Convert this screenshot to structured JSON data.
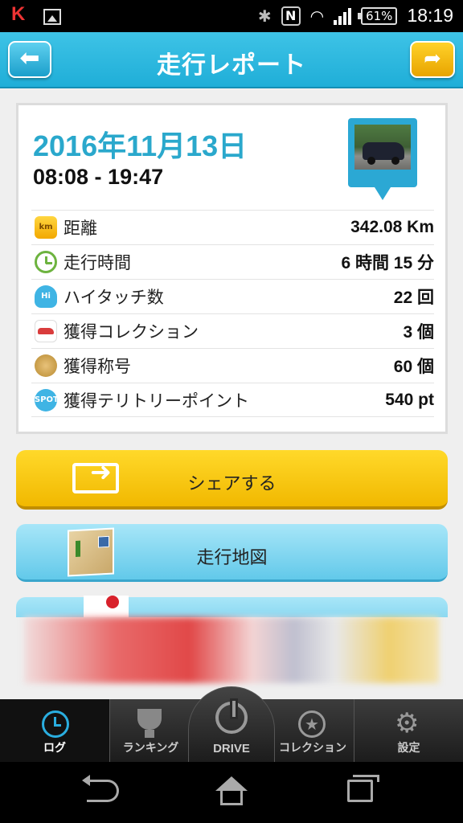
{
  "status_bar": {
    "battery": "61%",
    "time": "18:19"
  },
  "header": {
    "title": "走行レポート",
    "back_icon": "arrow-left-icon",
    "share_icon": "share-icon"
  },
  "report": {
    "date": "2016年11月13日",
    "time_range": "08:08 - 19:47",
    "rows": [
      {
        "icon": "km-icon",
        "icon_text": "km",
        "label": "距離",
        "value": "342.08 Km"
      },
      {
        "icon": "clock-icon",
        "icon_text": "",
        "label": "走行時間",
        "value": "6 時間 15 分"
      },
      {
        "icon": "hi-touch-icon",
        "icon_text": "Hi",
        "label": "ハイタッチ数",
        "value": "22 回"
      },
      {
        "icon": "car-icon",
        "icon_text": "",
        "label": "獲得コレクション",
        "value": "3 個"
      },
      {
        "icon": "medal-icon",
        "icon_text": "",
        "label": "獲得称号",
        "value": "60 個"
      },
      {
        "icon": "spot-icon",
        "icon_text": "SPOT",
        "label": "獲得テリトリーポイント",
        "value": "540 pt"
      }
    ]
  },
  "actions": {
    "share_label": "シェアする",
    "map_label": "走行地図"
  },
  "tabbar": {
    "tabs": [
      {
        "label": "ログ",
        "icon": "log-clock-icon",
        "active": true
      },
      {
        "label": "ランキング",
        "icon": "trophy-icon",
        "active": false
      },
      {
        "label": "DRIVE",
        "icon": "power-icon",
        "active": false
      },
      {
        "label": "コレクション",
        "icon": "star-icon",
        "active": false
      },
      {
        "label": "設定",
        "icon": "gear-icon",
        "active": false
      }
    ]
  },
  "colors": {
    "header": "#1faed8",
    "date_text": "#2aa8cc",
    "share_button": "#f1b800",
    "map_button": "#62c9ea",
    "tab_active": "#2aaee0"
  }
}
